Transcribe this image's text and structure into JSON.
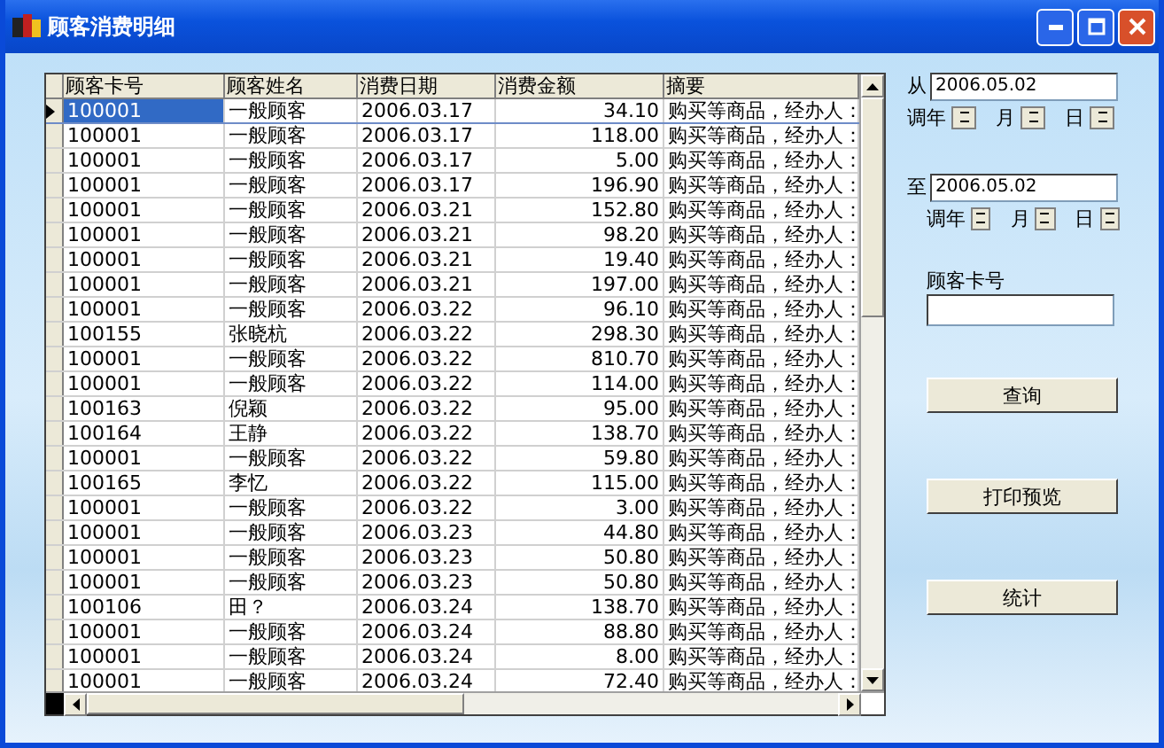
{
  "window": {
    "title": "顾客消费明细"
  },
  "table": {
    "columns": [
      "顾客卡号",
      "顾客姓名",
      "消费日期",
      "消费金额",
      "摘要"
    ],
    "rows": [
      {
        "cells": [
          "100001",
          "一般顾客",
          "2006.03.17",
          "34.10",
          "购买等商品，经办人："
        ],
        "selected": true
      },
      {
        "cells": [
          "100001",
          "一般顾客",
          "2006.03.17",
          "118.00",
          "购买等商品，经办人："
        ],
        "selected": false
      },
      {
        "cells": [
          "100001",
          "一般顾客",
          "2006.03.17",
          "5.00",
          "购买等商品，经办人："
        ],
        "selected": false
      },
      {
        "cells": [
          "100001",
          "一般顾客",
          "2006.03.17",
          "196.90",
          "购买等商品，经办人："
        ],
        "selected": false
      },
      {
        "cells": [
          "100001",
          "一般顾客",
          "2006.03.21",
          "152.80",
          "购买等商品，经办人："
        ],
        "selected": false
      },
      {
        "cells": [
          "100001",
          "一般顾客",
          "2006.03.21",
          "98.20",
          "购买等商品，经办人："
        ],
        "selected": false
      },
      {
        "cells": [
          "100001",
          "一般顾客",
          "2006.03.21",
          "19.40",
          "购买等商品，经办人："
        ],
        "selected": false
      },
      {
        "cells": [
          "100001",
          "一般顾客",
          "2006.03.21",
          "197.00",
          "购买等商品，经办人："
        ],
        "selected": false
      },
      {
        "cells": [
          "100001",
          "一般顾客",
          "2006.03.22",
          "96.10",
          "购买等商品，经办人："
        ],
        "selected": false
      },
      {
        "cells": [
          "100155",
          "张晓杭",
          "2006.03.22",
          "298.30",
          "购买等商品，经办人："
        ],
        "selected": false
      },
      {
        "cells": [
          "100001",
          "一般顾客",
          "2006.03.22",
          "810.70",
          "购买等商品，经办人："
        ],
        "selected": false
      },
      {
        "cells": [
          "100001",
          "一般顾客",
          "2006.03.22",
          "114.00",
          "购买等商品，经办人："
        ],
        "selected": false
      },
      {
        "cells": [
          "100163",
          "倪颖",
          "2006.03.22",
          "95.00",
          "购买等商品，经办人："
        ],
        "selected": false
      },
      {
        "cells": [
          "100164",
          "王静",
          "2006.03.22",
          "138.70",
          "购买等商品，经办人："
        ],
        "selected": false
      },
      {
        "cells": [
          "100001",
          "一般顾客",
          "2006.03.22",
          "59.80",
          "购买等商品，经办人："
        ],
        "selected": false
      },
      {
        "cells": [
          "100165",
          "李忆",
          "2006.03.22",
          "115.00",
          "购买等商品，经办人："
        ],
        "selected": false
      },
      {
        "cells": [
          "100001",
          "一般顾客",
          "2006.03.22",
          "3.00",
          "购买等商品，经办人："
        ],
        "selected": false
      },
      {
        "cells": [
          "100001",
          "一般顾客",
          "2006.03.23",
          "44.80",
          "购买等商品，经办人："
        ],
        "selected": false
      },
      {
        "cells": [
          "100001",
          "一般顾客",
          "2006.03.23",
          "50.80",
          "购买等商品，经办人："
        ],
        "selected": false
      },
      {
        "cells": [
          "100001",
          "一般顾客",
          "2006.03.23",
          "50.80",
          "购买等商品，经办人："
        ],
        "selected": false
      },
      {
        "cells": [
          "100106",
          "田？",
          "2006.03.24",
          "138.70",
          "购买等商品，经办人："
        ],
        "selected": false
      },
      {
        "cells": [
          "100001",
          "一般顾客",
          "2006.03.24",
          "88.80",
          "购买等商品，经办人："
        ],
        "selected": false
      },
      {
        "cells": [
          "100001",
          "一般顾客",
          "2006.03.24",
          "8.00",
          "购买等商品，经办人："
        ],
        "selected": false
      },
      {
        "cells": [
          "100001",
          "一般顾客",
          "2006.03.24",
          "72.40",
          "购买等商品，经办人："
        ],
        "selected": false
      }
    ]
  },
  "from": {
    "label": "从",
    "value": "2006.05.02",
    "spins": [
      "调年",
      "月",
      "日"
    ]
  },
  "to": {
    "label": "至",
    "value": "2006.05.02",
    "spins": [
      "调年",
      "月",
      "日"
    ]
  },
  "card_field": {
    "label": "顾客卡号"
  },
  "buttons": [
    "查询",
    "打印预览",
    "统计"
  ]
}
